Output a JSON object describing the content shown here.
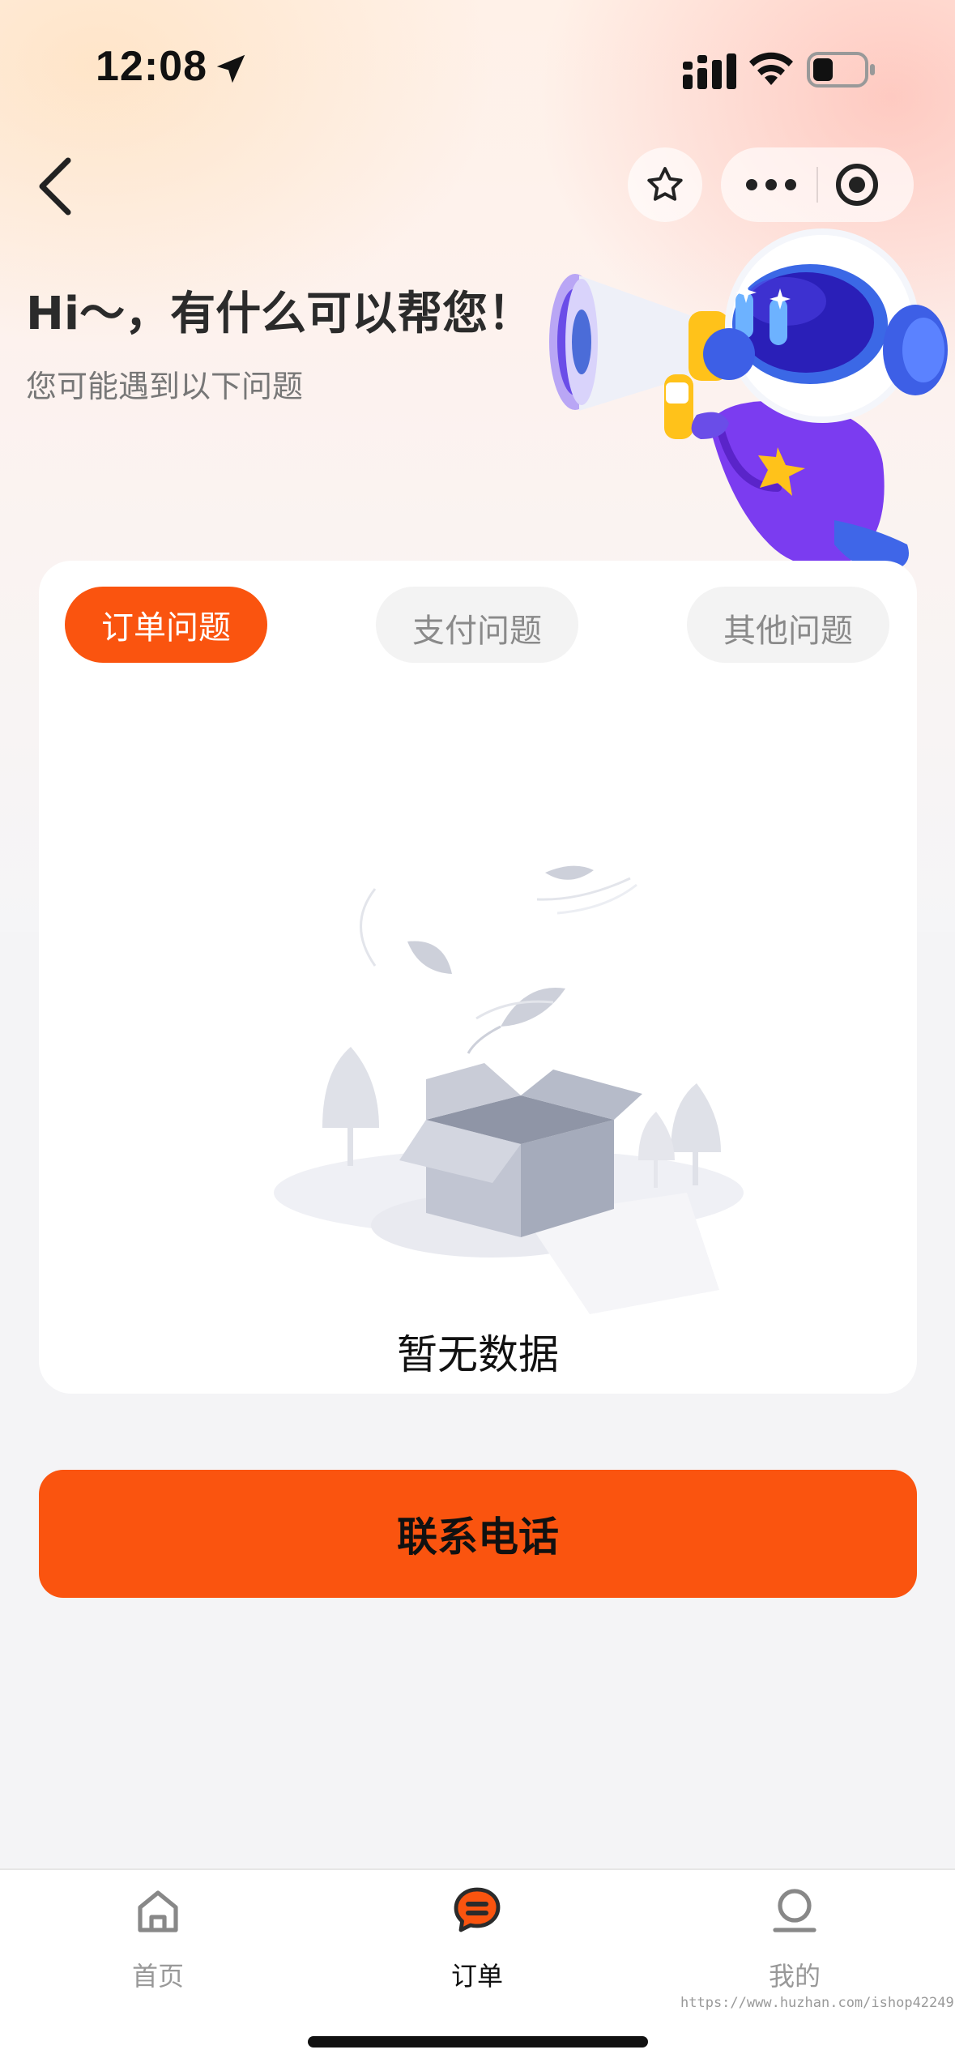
{
  "status_bar": {
    "time": "12:08",
    "icons": [
      "location-arrow-icon",
      "signal-icon",
      "wifi-icon",
      "battery-icon"
    ]
  },
  "nav": {
    "icons": [
      "back-chevron-icon",
      "star-icon",
      "more-dots-icon",
      "target-icon"
    ]
  },
  "header": {
    "greeting": "Hi～，有什么可以帮您！",
    "subtitle": "您可能遇到以下问题"
  },
  "tabs": [
    {
      "label": "订单问题",
      "active": true
    },
    {
      "label": "支付问题",
      "active": false
    },
    {
      "label": "其他问题",
      "active": false
    }
  ],
  "empty_state": {
    "text": "暂无数据"
  },
  "contact_button": {
    "label": "联系电话"
  },
  "tabbar": [
    {
      "label": "首页",
      "icon": "home-icon",
      "active": false
    },
    {
      "label": "订单",
      "icon": "chat-bubble-icon",
      "active": true
    },
    {
      "label": "我的",
      "icon": "user-icon",
      "active": false
    }
  ],
  "watermark": "https://www.huzhan.com/ishop42249",
  "colors": {
    "accent": "#fa540f",
    "text_dark": "#2b2b2b",
    "text_muted": "#8a8a8a"
  }
}
